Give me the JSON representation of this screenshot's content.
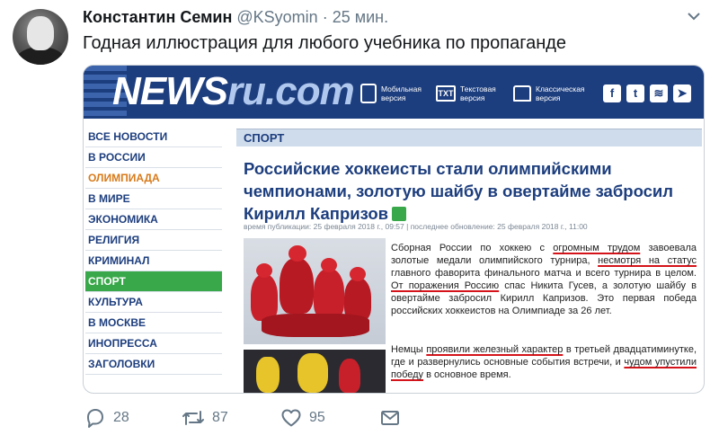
{
  "tweet": {
    "author_name": "Константин Семин",
    "handle": "@KSyomin",
    "separator": "·",
    "time": "25 мин.",
    "text": "Годная иллюстрация для любого учебника по пропаганде"
  },
  "site": {
    "logo_main": "NEWS",
    "logo_suffix": "ru.com",
    "nav": [
      {
        "icon": "mobile-phone-icon",
        "label": "Мобильная версия"
      },
      {
        "icon": "txt-document-icon",
        "label": "Текстовая версия",
        "icon_text": "TXT"
      },
      {
        "icon": "print-icon",
        "label": "Классическая версия"
      }
    ],
    "social": [
      {
        "icon": "facebook-icon",
        "glyph": "f"
      },
      {
        "icon": "twitter-icon",
        "glyph": "t"
      },
      {
        "icon": "rss-icon",
        "glyph": "≋"
      },
      {
        "icon": "telegram-icon",
        "glyph": "➤"
      }
    ],
    "menu": [
      "ВСЕ НОВОСТИ",
      "В РОССИИ",
      "ОЛИМПИАДА",
      "В МИРЕ",
      "ЭКОНОМИКА",
      "РЕЛИГИЯ",
      "КРИМИНАЛ",
      "СПОРТ",
      "КУЛЬТУРА",
      "В МОСКВЕ",
      "ИНОПРЕССА",
      "ЗАГОЛОВКИ"
    ],
    "section": "СПОРТ",
    "headline": "Российские хоккеисты стали олимпийскими чемпионами, золотую шайбу в овертайме забросил Кирилл Капризов",
    "meta": "время публикации: 25 февраля 2018 г., 09:57 | последнее обновление: 25 февраля 2018 г., 11:00",
    "p1": {
      "a": "Сборная России по хоккею с ",
      "u1": "огромным трудом",
      "b": " завоевала золотые медали олимпийского турнира, ",
      "u2": "несмотря на статус",
      "c": " главного фаворита финального матча и всего турнира в целом. ",
      "u3": "От поражения Россию",
      "d": " спас Никита Гусев, а золотую шайбу в овертайме забросил Кирилл Капризов. Это первая победа российских хоккеистов на Олимпиаде за 26 лет."
    },
    "p2": {
      "a": "Немцы ",
      "u1": "проявили железный характер",
      "b": " в третьей двадцатиминутке, где и развернулись основные события встречи, и ",
      "u2": "чудом упустили победу",
      "c": " в основное время."
    }
  },
  "actions": {
    "replies": "28",
    "retweets": "87",
    "likes": "95"
  },
  "colors": {
    "site_blue": "#1d3e7e",
    "active_green": "#39a84a",
    "olympic_orange": "#d87a1a",
    "underline_red": "#d4141a"
  }
}
